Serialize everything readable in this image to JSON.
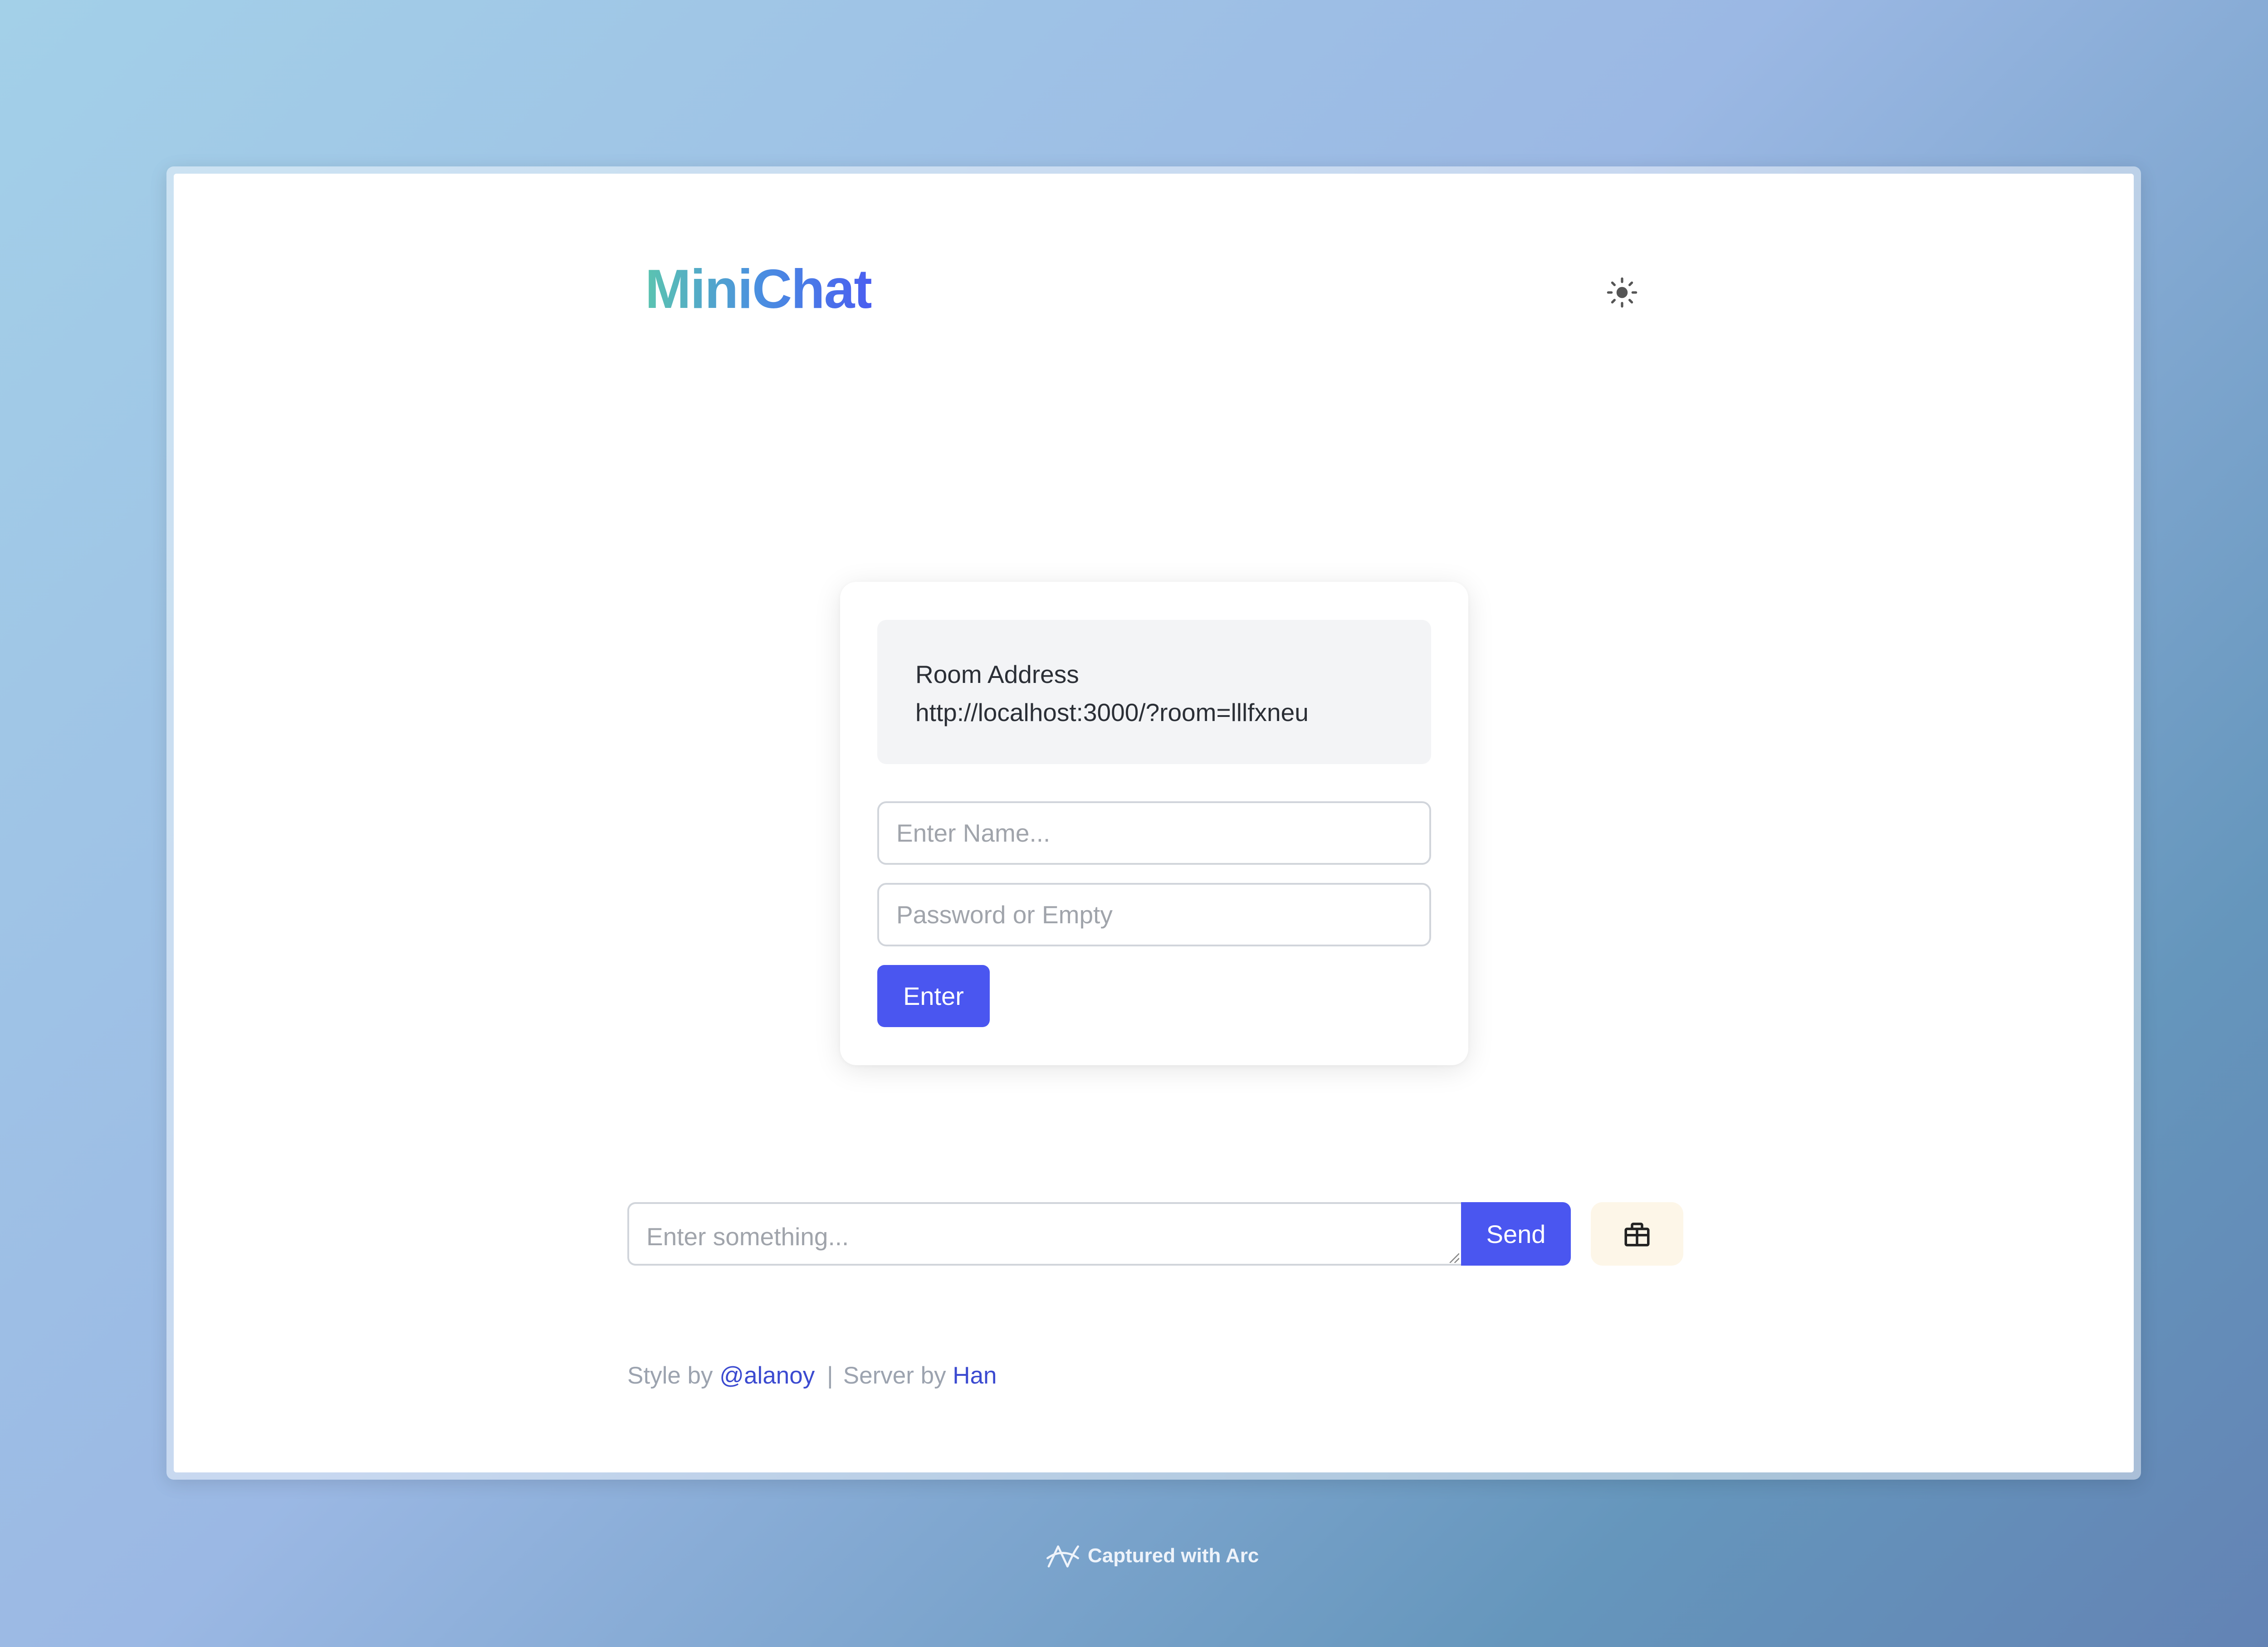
{
  "app": {
    "logo_text": "MiniChat"
  },
  "header": {
    "theme_toggle_icon": "sun-icon"
  },
  "room_card": {
    "room_label": "Room Address",
    "room_url": "http://localhost:3000/?room=lllfxneu",
    "name_placeholder": "Enter Name...",
    "password_placeholder": "Password or Empty",
    "enter_label": "Enter"
  },
  "composer": {
    "message_placeholder": "Enter something...",
    "send_label": "Send",
    "gift_icon": "gift-icon"
  },
  "footer": {
    "style_prefix": "Style by ",
    "style_link": "@alanoy",
    "separator": "|",
    "server_prefix": "Server by ",
    "server_link": "Han"
  },
  "capture": {
    "caption": "Captured with Arc",
    "icon": "arc-logo-icon"
  },
  "colors": {
    "accent": "#4a56f0",
    "link": "#3b4ad0",
    "logo_gradient_start": "#5bc4b0",
    "logo_gradient_end": "#4a5ef0",
    "gift_bg": "#fdf6e8"
  }
}
